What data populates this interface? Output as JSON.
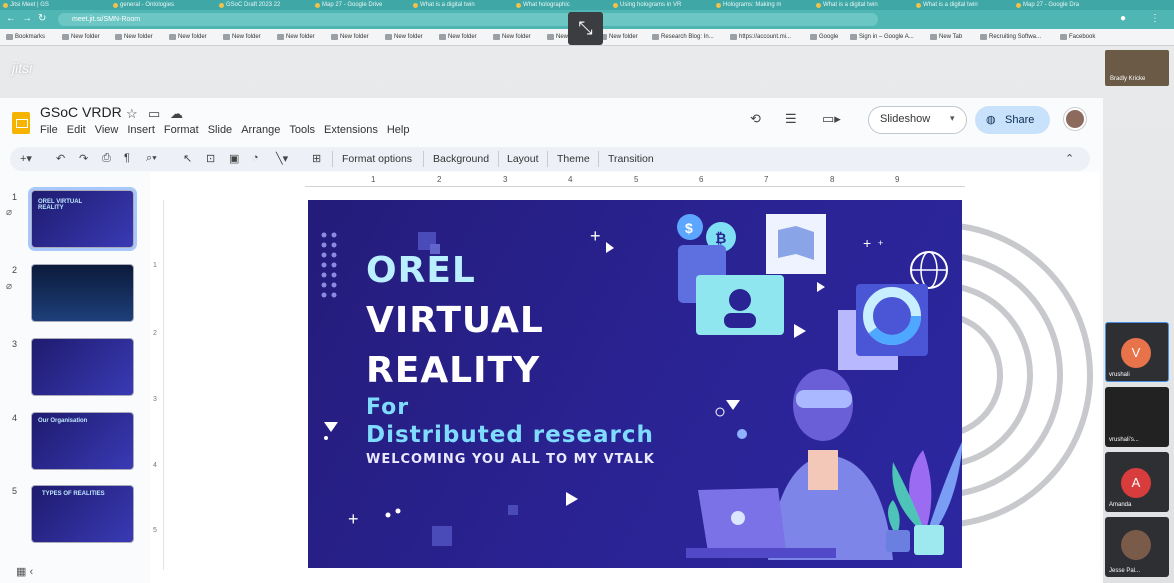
{
  "browser": {
    "tabs": [
      "Jitsi Meet | GS",
      "general - Ontologies",
      "GSoC Draft 2023 22",
      "Map 27 - Google Drive",
      "What is a digital twin",
      "What holographic dash",
      "Using holograms in VR",
      "Holograms: Making m",
      "What is a digital twin",
      "What is a digital twin",
      "Map 27 - Google Dra"
    ],
    "url": "meet.jit.si/SMN-Room",
    "bookmarks": [
      "Bookmarks",
      "New folder",
      "New folder",
      "New folder",
      "New folder",
      "New folder",
      "New folder",
      "New folder",
      "New folder",
      "New folder",
      "New",
      "New folder",
      "Research Blog: In...",
      "https://account.mi...",
      "Google",
      "Sign in – Google A...",
      "New Tab",
      "Recruiting Softwa...",
      "Facebook"
    ]
  },
  "jitsi": {
    "logo": "jitsi",
    "presenter_name": "Bradly Kricke",
    "participants": [
      {
        "initial": "V",
        "name": "vrushali",
        "color": "#e8734a"
      },
      {
        "initial": "",
        "name": "vrushali's...",
        "color": ""
      },
      {
        "initial": "A",
        "name": "Amanda",
        "color": "#d93c3c"
      },
      {
        "initial": "",
        "name": "Jesse Pal...",
        "color": ""
      }
    ]
  },
  "slides": {
    "doc_title": "GSoC VRDR",
    "menu": [
      "File",
      "Edit",
      "View",
      "Insert",
      "Format",
      "Slide",
      "Arrange",
      "Tools",
      "Extensions",
      "Help"
    ],
    "slideshow_label": "Slideshow",
    "share_label": "Share",
    "toolbar": [
      "Format options",
      "Background",
      "Layout",
      "Theme",
      "Transition"
    ],
    "ruler_top": [
      "1",
      "2",
      "3",
      "4",
      "5",
      "6",
      "7",
      "8",
      "9"
    ],
    "ruler_left": [
      "1",
      "2",
      "3",
      "4",
      "5"
    ],
    "thumbnails": [
      {
        "num": "1",
        "text": "OREL VIRTUAL REALITY"
      },
      {
        "num": "2",
        "text": ""
      },
      {
        "num": "3",
        "text": ""
      },
      {
        "num": "4",
        "text": "Our Organisation"
      },
      {
        "num": "5",
        "text": "TYPES OF REALITIES"
      }
    ],
    "slide": {
      "line1": "OREL",
      "line2": "VIRTUAL",
      "line3": "REALITY",
      "line4": "For",
      "line5": "Distributed research",
      "line6": "WELCOMING YOU ALL TO MY VTALK"
    }
  }
}
